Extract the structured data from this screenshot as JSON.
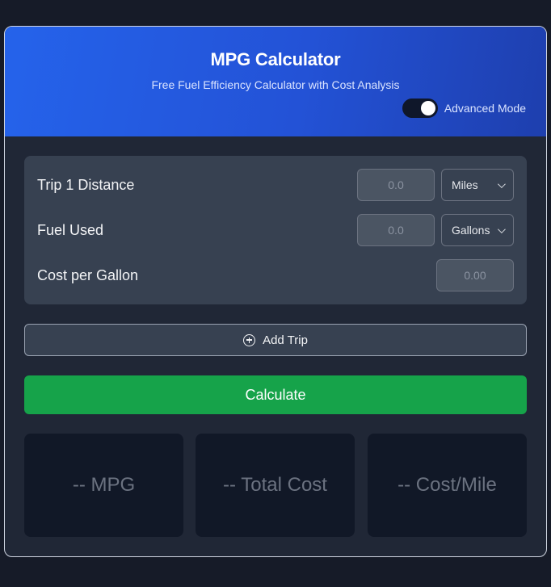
{
  "header": {
    "title": "MPG Calculator",
    "subtitle": "Free Fuel Efficiency Calculator with Cost Analysis",
    "advanced_mode_label": "Advanced Mode",
    "advanced_mode_on": true
  },
  "form": {
    "trip_distance": {
      "label": "Trip 1 Distance",
      "value": "",
      "placeholder": "0.0",
      "unit": "Miles"
    },
    "fuel_used": {
      "label": "Fuel Used",
      "value": "",
      "placeholder": "0.0",
      "unit": "Gallons"
    },
    "cost_per_gallon": {
      "label": "Cost per Gallon",
      "value": "",
      "placeholder": "0.00"
    }
  },
  "actions": {
    "add_trip_label": "Add Trip",
    "calculate_label": "Calculate"
  },
  "results": {
    "mpg": "-- MPG",
    "total_cost": "-- Total Cost",
    "cost_per_mile": "-- Cost/Mile"
  },
  "colors": {
    "background": "#161b28",
    "card": "#202736",
    "header_gradient_start": "#2563eb",
    "header_gradient_end": "#1e3fae",
    "calculate_button": "#16a34a",
    "result_card": "#111827"
  },
  "icons": {
    "add_trip": "plus-circle-icon",
    "select_arrow": "chevron-down-icon"
  }
}
